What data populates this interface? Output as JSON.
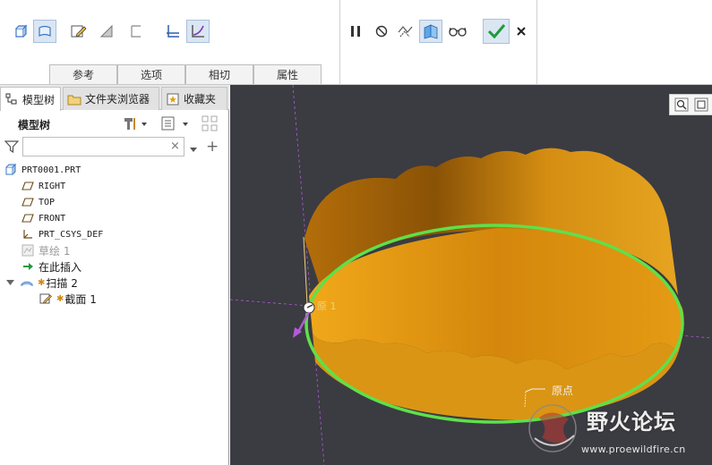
{
  "ribbon": {
    "tabs": [
      "参考",
      "选项",
      "相切",
      "属性"
    ]
  },
  "left_panel": {
    "tabs": [
      "模型树",
      "文件夹浏览器",
      "收藏夹"
    ],
    "model_tree_title": "模型树",
    "filter_placeholder": "",
    "clear_symbol": "×",
    "add_symbol": "+",
    "tree": [
      {
        "label": "PRT0001.PRT",
        "icon": "part-icon"
      },
      {
        "label": "RIGHT",
        "icon": "datum-plane-icon"
      },
      {
        "label": "TOP",
        "icon": "datum-plane-icon"
      },
      {
        "label": "FRONT",
        "icon": "datum-plane-icon"
      },
      {
        "label": "PRT_CSYS_DEF",
        "icon": "csys-icon"
      },
      {
        "label": "草绘 1",
        "icon": "sketch-icon"
      },
      {
        "label": "在此插入",
        "icon": "insert-here-arrow-icon"
      },
      {
        "label": "扫描 2",
        "icon": "sweep-icon"
      },
      {
        "label": "截面 1",
        "icon": "section-pencil-icon"
      }
    ]
  },
  "viewport": {
    "start_label": "原点",
    "trajectory_label": "原点",
    "origin_annotation": "原点",
    "start_point_label": "原 1"
  },
  "watermark": {
    "title": "野火论坛",
    "url": "www.proewildfire.cn"
  },
  "colors": {
    "viewport_bg": "#3b3b42",
    "surface": "#e09a14",
    "trajectory": "#5fe04a",
    "datum": "#b45ad8",
    "accept": "#1f9a3c"
  }
}
